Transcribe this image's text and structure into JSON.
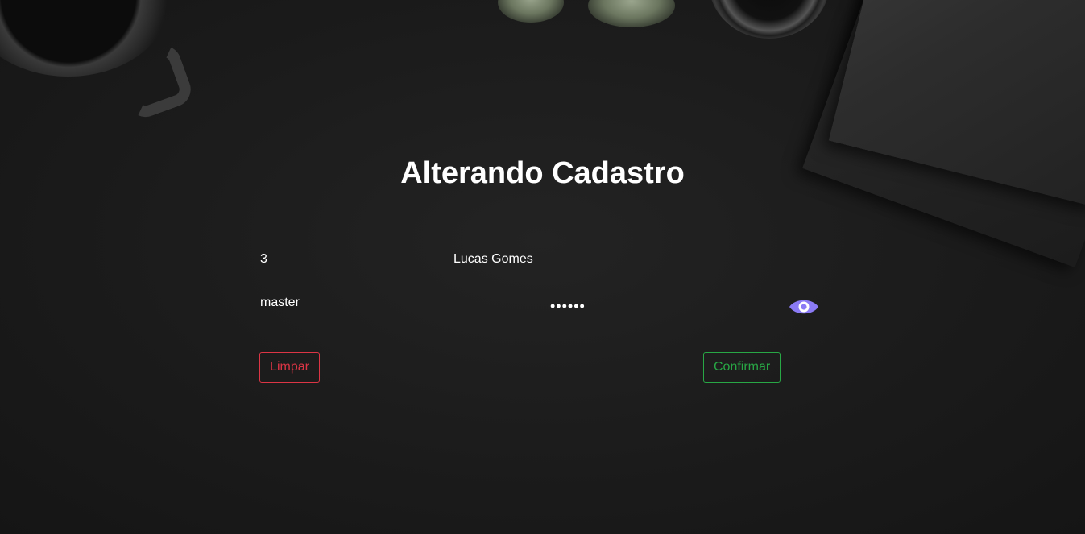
{
  "page": {
    "title": "Alterando Cadastro"
  },
  "form": {
    "id_value": "3",
    "name_value": "Lucas Gomes",
    "username_value": "master",
    "password_value": "••••••",
    "toggle_password_icon": "eye-icon"
  },
  "buttons": {
    "clear_label": "Limpar",
    "confirm_label": "Confirmar"
  },
  "colors": {
    "clear": "#dc3545",
    "confirm": "#28a745",
    "eye_icon": "#8b7bf5"
  }
}
